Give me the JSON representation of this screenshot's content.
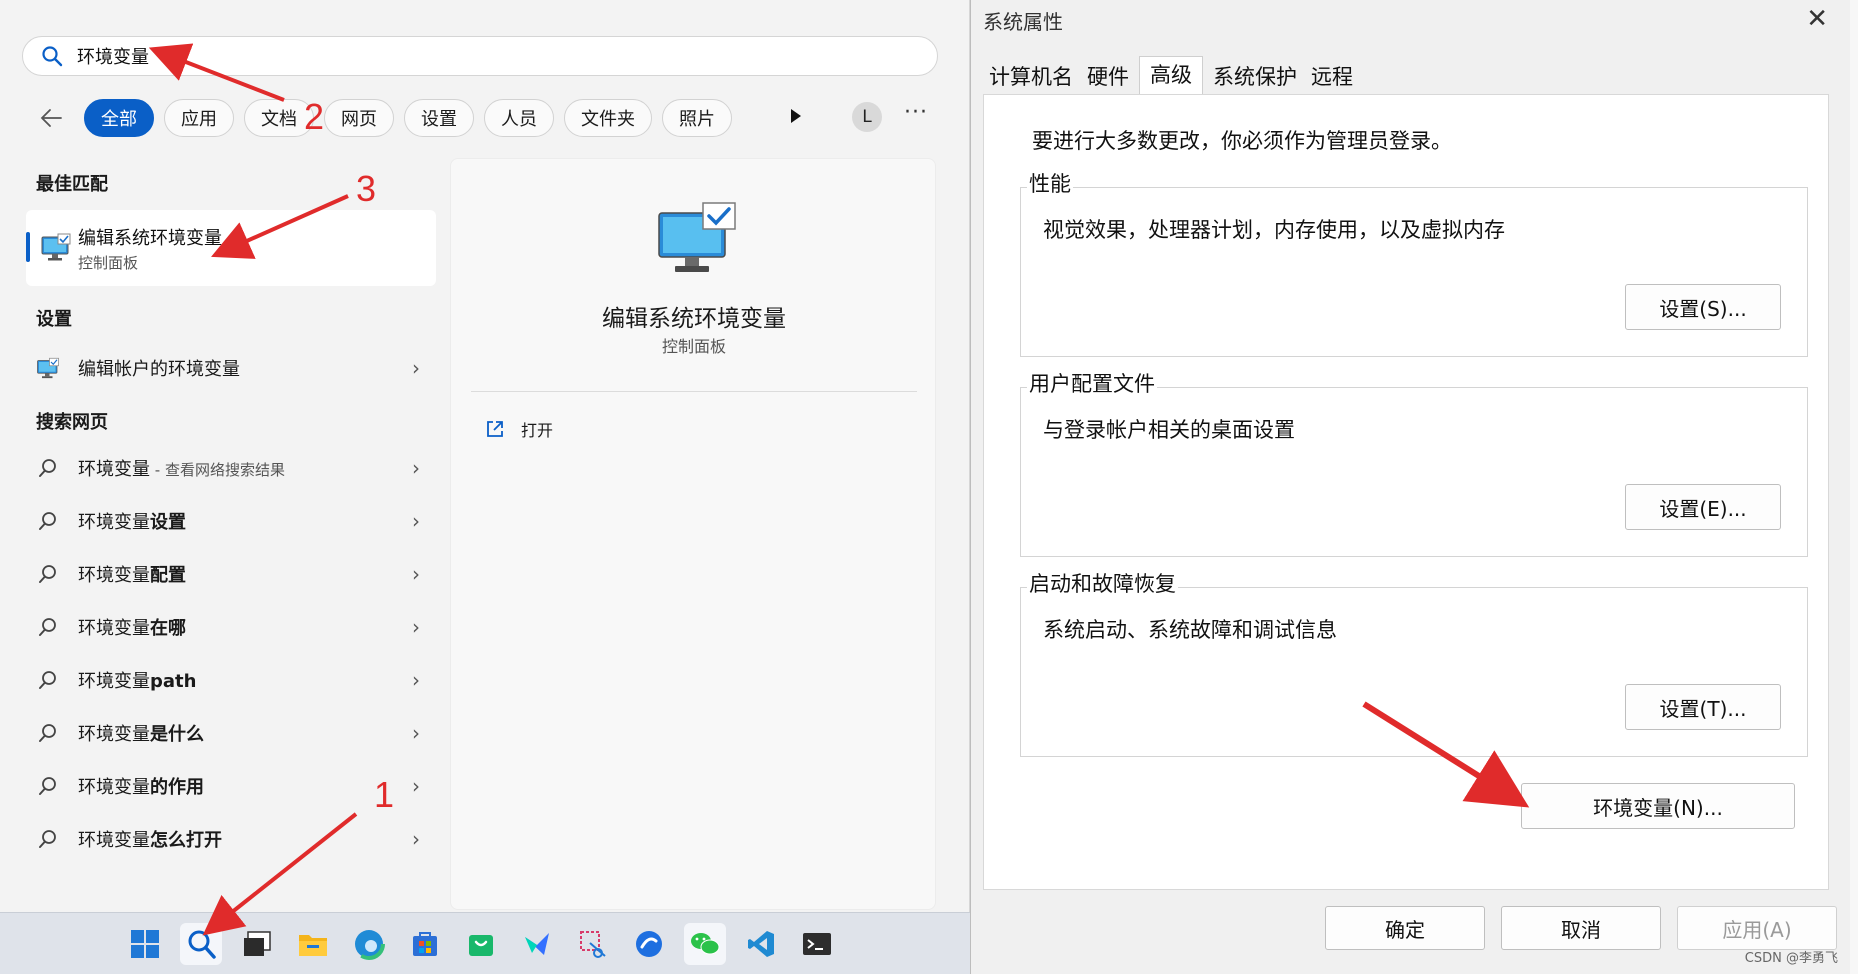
{
  "search": {
    "query": "环境变量",
    "filters": [
      "全部",
      "应用",
      "文档",
      "网页",
      "设置",
      "人员",
      "文件夹",
      "照片"
    ],
    "avatar_letter": "L",
    "more": "···"
  },
  "results": {
    "best_match_title": "最佳匹配",
    "best_match": {
      "title": "编辑系统环境变量",
      "subtitle": "控制面板"
    },
    "settings_title": "设置",
    "settings_item": "编辑帐户的环境变量",
    "web_title": "搜索网页",
    "web_items": [
      {
        "prefix": "环境变量",
        "bold": "",
        "suffix": " - 查看网络搜索结果"
      },
      {
        "prefix": "环境变量",
        "bold": "设置",
        "suffix": ""
      },
      {
        "prefix": "环境变量",
        "bold": "配置",
        "suffix": ""
      },
      {
        "prefix": "环境变量",
        "bold": "在哪",
        "suffix": ""
      },
      {
        "prefix": "环境变量",
        "bold": "path",
        "suffix": ""
      },
      {
        "prefix": "环境变量",
        "bold": "是什么",
        "suffix": ""
      },
      {
        "prefix": "环境变量",
        "bold": "的作用",
        "suffix": ""
      },
      {
        "prefix": "环境变量",
        "bold": "怎么打开",
        "suffix": ""
      }
    ]
  },
  "preview": {
    "title": "编辑系统环境变量",
    "subtitle": "控制面板",
    "open_label": "打开"
  },
  "taskbar": {
    "icons": [
      "windows-start-icon",
      "search-icon",
      "task-view-icon",
      "file-explorer-icon",
      "edge-icon",
      "store-icon",
      "shopping-icon",
      "feishu-icon",
      "snipping-icon",
      "browser-icon",
      "wechat-icon",
      "vscode-icon",
      "terminal-icon"
    ]
  },
  "dialog": {
    "title": "系统属性",
    "tabs": [
      "计算机名",
      "硬件",
      "高级",
      "系统保护",
      "远程"
    ],
    "active_tab": "高级",
    "admin_note": "要进行大多数更改，你必须作为管理员登录。",
    "groups": [
      {
        "legend": "性能",
        "desc": "视觉效果，处理器计划，内存使用，以及虚拟内存",
        "button": "设置(S)..."
      },
      {
        "legend": "用户配置文件",
        "desc": "与登录帐户相关的桌面设置",
        "button": "设置(E)..."
      },
      {
        "legend": "启动和故障恢复",
        "desc": "系统启动、系统故障和调试信息",
        "button": "设置(T)..."
      }
    ],
    "env_button": "环境变量(N)...",
    "ok": "确定",
    "cancel": "取消",
    "apply": "应用(A)"
  },
  "annotations": {
    "n1": "1",
    "n2": "2",
    "n3": "3"
  },
  "watermark": "CSDN @李勇飞",
  "colors": {
    "accent": "#0a5fc7",
    "annotation": "#e02b2b"
  }
}
